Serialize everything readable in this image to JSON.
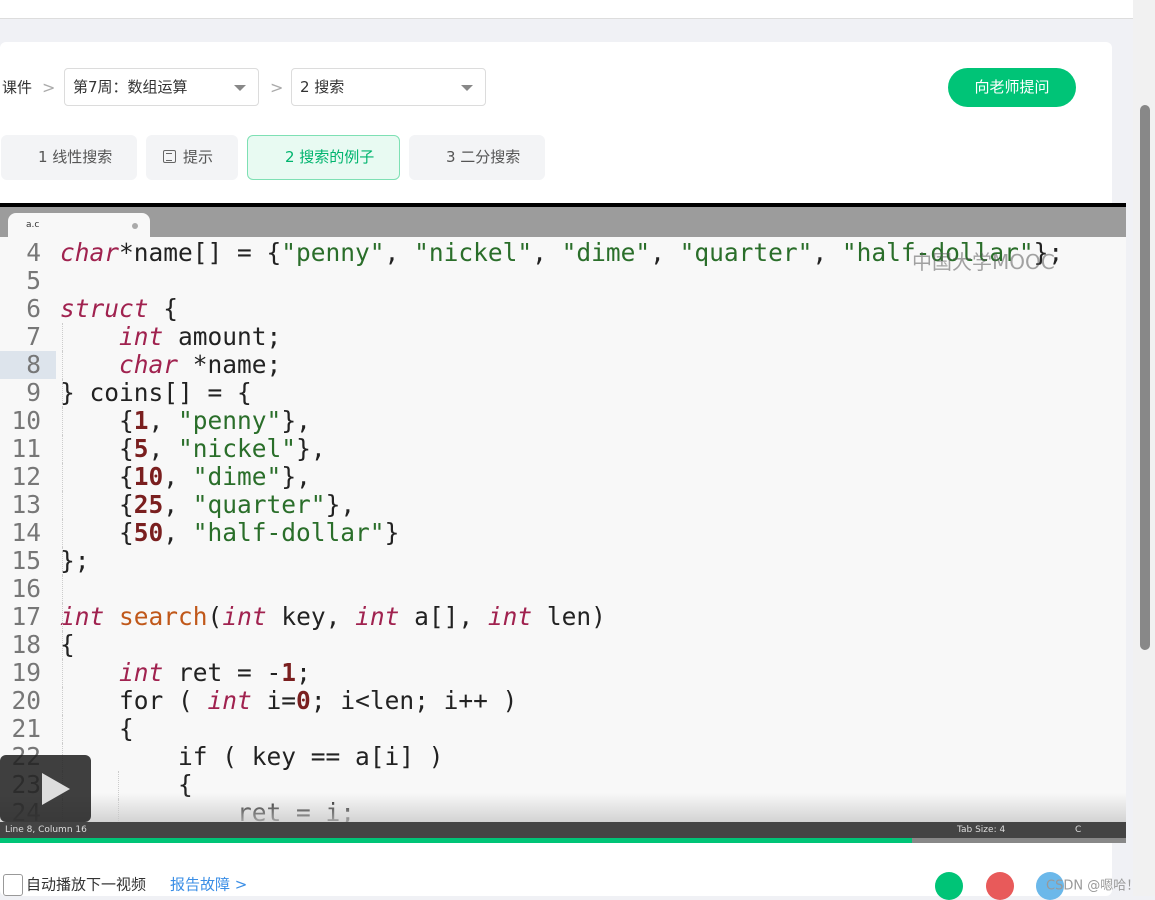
{
  "breadcrumb": {
    "root": "课件",
    "week": "第7周：数组运算",
    "section": "2 搜索"
  },
  "ask_button": "向老师提问",
  "tabs": [
    {
      "label": "1 线性搜索",
      "icon": "video-icon",
      "active": false
    },
    {
      "label": "提示",
      "icon": "document-icon",
      "active": false
    },
    {
      "label": "2 搜索的例子",
      "icon": "video-icon",
      "active": true
    },
    {
      "label": "3 二分搜索",
      "icon": "video-icon",
      "active": false
    }
  ],
  "editor": {
    "file_tab": "a.c",
    "watermark": "中国大学MOOC",
    "current_line": 8,
    "lines": [
      {
        "n": "4",
        "t": [
          [
            "kw",
            "char"
          ],
          [
            "",
            "*name[] = {"
          ],
          [
            "str",
            "\"penny\""
          ],
          [
            "",
            ", "
          ],
          [
            "str",
            "\"nickel\""
          ],
          [
            "",
            ", "
          ],
          [
            "str",
            "\"dime\""
          ],
          [
            "",
            ", "
          ],
          [
            "str",
            "\"quarter\""
          ],
          [
            "",
            ", "
          ],
          [
            "str",
            "\"half-dollar\""
          ],
          [
            "",
            "};"
          ]
        ]
      },
      {
        "n": "5",
        "t": []
      },
      {
        "n": "6",
        "t": [
          [
            "kw",
            "struct"
          ],
          [
            "",
            " {"
          ]
        ]
      },
      {
        "n": "7",
        "t": [
          [
            "",
            "    "
          ],
          [
            "kw",
            "int"
          ],
          [
            "",
            " amount;"
          ]
        ]
      },
      {
        "n": "8",
        "t": [
          [
            "",
            "    "
          ],
          [
            "kw",
            "char"
          ],
          [
            "",
            " *name;"
          ]
        ]
      },
      {
        "n": "9",
        "t": [
          [
            "",
            "} coins[] = {"
          ]
        ]
      },
      {
        "n": "10",
        "t": [
          [
            "",
            "    {"
          ],
          [
            "n",
            "1"
          ],
          [
            "",
            ", "
          ],
          [
            "str",
            "\"penny\""
          ],
          [
            "",
            "},"
          ]
        ]
      },
      {
        "n": "11",
        "t": [
          [
            "",
            "    {"
          ],
          [
            "n",
            "5"
          ],
          [
            "",
            ", "
          ],
          [
            "str",
            "\"nickel\""
          ],
          [
            "",
            "},"
          ]
        ]
      },
      {
        "n": "12",
        "t": [
          [
            "",
            "    {"
          ],
          [
            "n",
            "10"
          ],
          [
            "",
            ", "
          ],
          [
            "str",
            "\"dime\""
          ],
          [
            "",
            "},"
          ]
        ]
      },
      {
        "n": "13",
        "t": [
          [
            "",
            "    {"
          ],
          [
            "n",
            "25"
          ],
          [
            "",
            ", "
          ],
          [
            "str",
            "\"quarter\""
          ],
          [
            "",
            "},"
          ]
        ]
      },
      {
        "n": "14",
        "t": [
          [
            "",
            "    {"
          ],
          [
            "n",
            "50"
          ],
          [
            "",
            ", "
          ],
          [
            "str",
            "\"half-dollar\""
          ],
          [
            "",
            "}"
          ]
        ]
      },
      {
        "n": "15",
        "t": [
          [
            "",
            "};"
          ]
        ]
      },
      {
        "n": "16",
        "t": []
      },
      {
        "n": "17",
        "t": [
          [
            "kw",
            "int"
          ],
          [
            "",
            " "
          ],
          [
            "fn",
            "search"
          ],
          [
            "",
            "("
          ],
          [
            "kw",
            "int"
          ],
          [
            "",
            " key, "
          ],
          [
            "kw",
            "int"
          ],
          [
            "",
            " a[], "
          ],
          [
            "kw",
            "int"
          ],
          [
            "",
            " len)"
          ]
        ]
      },
      {
        "n": "18",
        "t": [
          [
            "",
            "{"
          ]
        ]
      },
      {
        "n": "19",
        "t": [
          [
            "",
            "    "
          ],
          [
            "kw",
            "int"
          ],
          [
            "",
            " ret = -"
          ],
          [
            "n",
            "1"
          ],
          [
            "",
            ";"
          ]
        ]
      },
      {
        "n": "20",
        "t": [
          [
            "",
            "    for ( "
          ],
          [
            "kw",
            "int"
          ],
          [
            "",
            " i="
          ],
          [
            "n",
            "0"
          ],
          [
            "",
            "; i<len; i++ )"
          ]
        ]
      },
      {
        "n": "21",
        "t": [
          [
            "",
            "    {"
          ]
        ]
      },
      {
        "n": "22",
        "t": [
          [
            "",
            "        if ( key == a[i] )"
          ]
        ]
      },
      {
        "n": "23",
        "t": [
          [
            "",
            "        {"
          ]
        ]
      },
      {
        "n": "24",
        "t": [
          [
            "",
            "            ret = i;"
          ]
        ]
      }
    ],
    "status_left": "Line 8, Column 16",
    "status_tab": "Tab Size: 4",
    "status_lang": "C"
  },
  "video_progress": 0.81,
  "footer": {
    "autoplay": "自动播放下一视频",
    "report": "报告故障 >",
    "credit": "CSDN @嗯哈！"
  },
  "colors": {
    "accent": "#00c477",
    "keyword": "#a0224f",
    "string": "#2a6e2a",
    "number": "#7a1f1f",
    "function": "#c0581a"
  }
}
